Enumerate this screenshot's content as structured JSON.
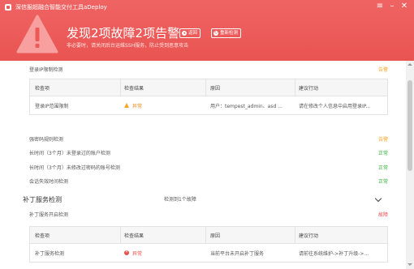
{
  "app": {
    "title": "深信服超融合智能交付工具aDeploy"
  },
  "window_controls": {
    "menu_glyph": "≡",
    "minimize_glyph": "–",
    "close_glyph": "✕"
  },
  "header": {
    "headline": "发现2项故障2项告警",
    "subtitle": "非必要时，请关闭后台运维SSH服务，防止受到恶意攻击",
    "back_button": "返回",
    "recheck_button": "重新检测",
    "back_icon": "arrow-back-icon",
    "recheck_icon": "refresh-icon"
  },
  "colors": {
    "header_bg": "#ec5a58",
    "warn": "#f5a623",
    "ok": "#3ab03e",
    "error": "#e8504d"
  },
  "checks": {
    "login_limit": {
      "label": "登录IP限制检测",
      "status": "告警"
    },
    "table1": {
      "headers": [
        "检查项",
        "检查结果",
        "原因",
        "建议行动"
      ],
      "row": {
        "item": "登录IP范围限制",
        "result": "异常",
        "reason": "用户：tempest_admin、asd ...",
        "action": "请在修改个人信息中启用登录IP..."
      }
    },
    "password_rule": {
      "label": "强密码规则检测",
      "status": "告警"
    },
    "inactive_accounts": {
      "label": "长时间（3个月）未登录过的账户检测",
      "status": "正常"
    },
    "password_age": {
      "label": "长时间（3个月）未修改过密码的账号检测",
      "status": "正常"
    },
    "session_timeout": {
      "label": "会话失效时间检测",
      "status": "正常"
    }
  },
  "patch_section": {
    "title": "补丁服务检测",
    "count_text": "检测到1个故障",
    "sub_label": "补丁服务开启检测",
    "sub_status": "故障",
    "table": {
      "headers": [
        "检查项",
        "检查结果",
        "原因",
        "建议行动"
      ],
      "row": {
        "item": "补丁服务检测",
        "result": "异常",
        "reason": "当前平台未开启补丁服务",
        "action": "请前往系统维护->补丁升级->..."
      }
    }
  }
}
